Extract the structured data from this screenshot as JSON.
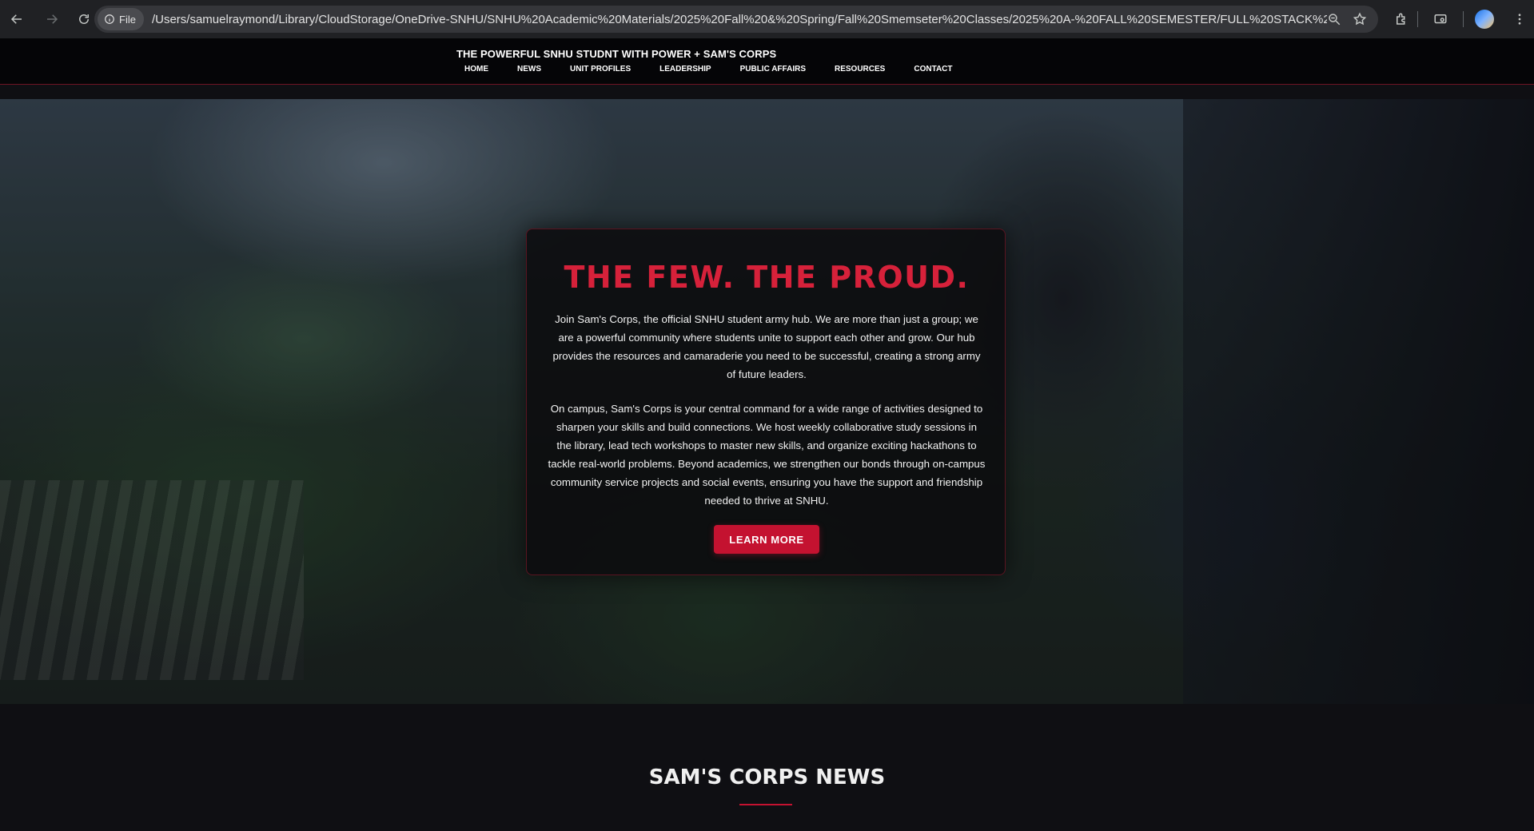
{
  "browser": {
    "chip_label": "File",
    "url": "/Users/samuelraymond/Library/CloudStorage/OneDrive-SNHU/SNHU%20Academic%20Materials/2025%20Fall%20&%20Spring/Fall%20Smemseter%20Classes/2025%20A-%20FALL%20SEMESTER/FULL%20STACK%20..."
  },
  "site": {
    "title": "THE POWERFUL SNHU STUDNT WITH POWER + SAM'S CORPS",
    "nav": [
      "HOME",
      "NEWS",
      "UNIT PROFILES",
      "LEADERSHIP",
      "PUBLIC AFFAIRS",
      "RESOURCES",
      "CONTACT"
    ]
  },
  "hero": {
    "headline": "THE FEW. THE PROUD.",
    "paragraph1": "Join Sam's Corps, the official SNHU student army hub. We are more than just a group; we are a powerful community where students unite to support each other and grow. Our hub provides the resources and camaraderie you need to be successful, creating a strong army of future leaders.",
    "paragraph2": "On campus, Sam's Corps is your central command for a wide range of activities designed to sharpen your skills and build connections. We host weekly collaborative study sessions in the library, lead tech workshops to master new skills, and organize exciting hackathons to tackle real-world problems. Beyond academics, we strengthen our bonds through on-campus community service projects and social events, ensuring you have the support and friendship needed to thrive at SNHU.",
    "button_label": "LEARN MORE"
  },
  "news": {
    "heading": "SAM'S CORPS NEWS"
  },
  "colors": {
    "accent": "#c41230",
    "headline": "#d6213a",
    "header_bg": "#050507",
    "page_bg": "#0f0f13"
  },
  "icons": [
    "back-icon",
    "forward-icon",
    "reload-icon",
    "info-icon",
    "zoom-icon",
    "star-icon",
    "extensions-icon",
    "cast-icon",
    "menu-icon"
  ]
}
